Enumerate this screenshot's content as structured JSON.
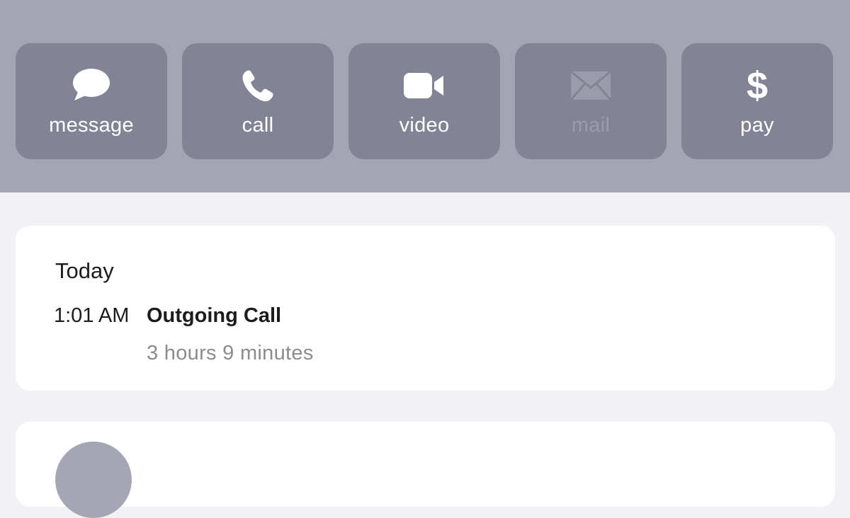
{
  "actions": [
    {
      "label": "message",
      "icon": "message-bubble-icon"
    },
    {
      "label": "call",
      "icon": "phone-icon"
    },
    {
      "label": "video",
      "icon": "video-camera-icon"
    },
    {
      "label": "mail",
      "icon": "mail-envelope-icon",
      "disabled": true
    },
    {
      "label": "pay",
      "icon": "dollar-icon",
      "symbol": "$"
    }
  ],
  "history": {
    "day": "Today",
    "entries": [
      {
        "time": "1:01 AM",
        "type": "Outgoing Call",
        "duration": "3 hours 9 minutes"
      }
    ]
  },
  "colors": {
    "header_bg": "#a3a5b2",
    "button_bg": "#828495",
    "page_bg": "#f2f1f6",
    "card_bg": "#ffffff",
    "secondary_text": "#8b8b90"
  }
}
